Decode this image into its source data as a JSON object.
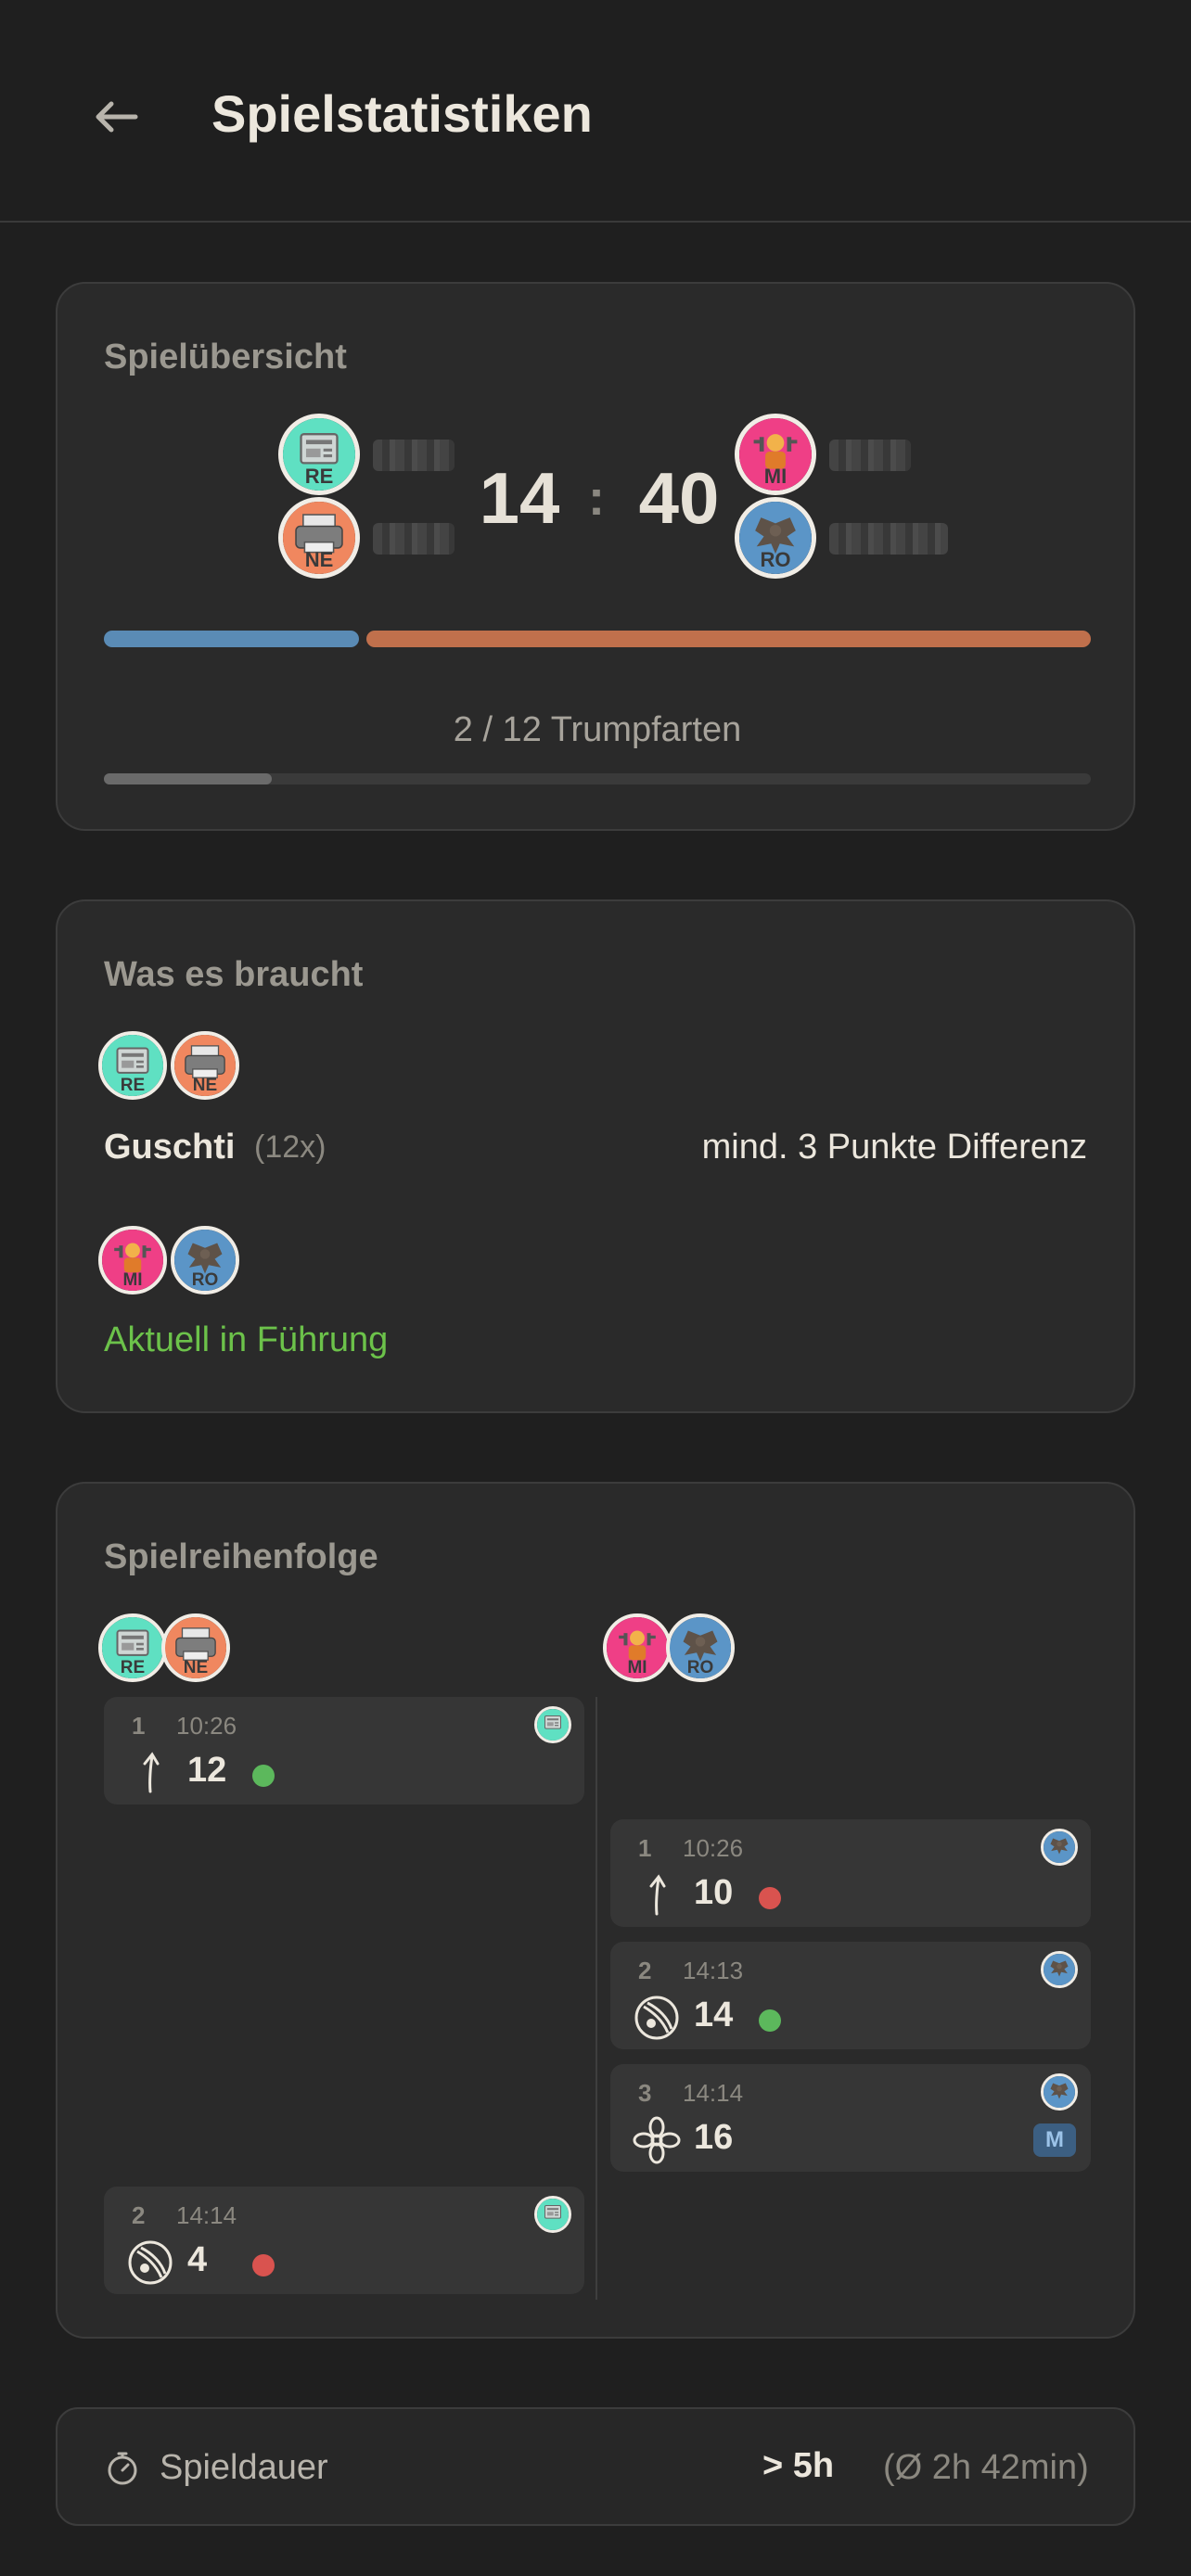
{
  "header": {
    "title": "Spielstatistiken"
  },
  "overview": {
    "title": "Spielübersicht",
    "team_a": {
      "players": [
        {
          "initials": "RE"
        },
        {
          "initials": "NE"
        }
      ],
      "score": "14"
    },
    "team_b": {
      "players": [
        {
          "initials": "MI"
        },
        {
          "initials": "RO"
        }
      ],
      "score": "40"
    },
    "separator": ":",
    "progress_text": "2 / 12 Trumpfarten",
    "trumpf_progress": 0.17,
    "score_share_a": 0.26
  },
  "needs": {
    "title": "Was es braucht",
    "team_a": {
      "players": [
        {
          "initials": "RE"
        },
        {
          "initials": "NE"
        }
      ],
      "label": "Guschti",
      "count": "(12x)",
      "requirement": "mind. 3 Punkte Differenz"
    },
    "team_b": {
      "players": [
        {
          "initials": "MI"
        },
        {
          "initials": "RO"
        }
      ],
      "status": "Aktuell in Führung"
    }
  },
  "order": {
    "title": "Spielreihenfolge",
    "team_a": {
      "players": [
        {
          "initials": "RE"
        },
        {
          "initials": "NE"
        }
      ]
    },
    "team_b": {
      "players": [
        {
          "initials": "MI"
        },
        {
          "initials": "RO"
        }
      ]
    },
    "rounds": [
      {
        "team": "a",
        "num": "1",
        "time": "10:26",
        "icon": "arrow-up-icon",
        "points": "12",
        "result": "win",
        "player": "RE"
      },
      {
        "team": "b",
        "num": "1",
        "time": "10:26",
        "icon": "arrow-up-icon",
        "points": "10",
        "result": "loss",
        "player": "RO"
      },
      {
        "team": "b",
        "num": "2",
        "time": "14:13",
        "icon": "bell-icon",
        "points": "14",
        "result": "win",
        "player": "RO"
      },
      {
        "team": "b",
        "num": "3",
        "time": "14:14",
        "icon": "flower-icon",
        "points": "16",
        "result": "",
        "player": "RO",
        "badge": "M"
      },
      {
        "team": "a",
        "num": "2",
        "time": "14:14",
        "icon": "bell-icon",
        "points": "4",
        "result": "loss",
        "player": "RE"
      }
    ]
  },
  "duration": {
    "label": "Spieldauer",
    "value": "> 5h",
    "average": "(Ø 2h 42min)"
  },
  "colors": {
    "win": "#5cb85c",
    "loss": "#d9534f",
    "lead": "#6cc24a",
    "blue": "#5a8bb5",
    "orange": "#c0704c"
  }
}
